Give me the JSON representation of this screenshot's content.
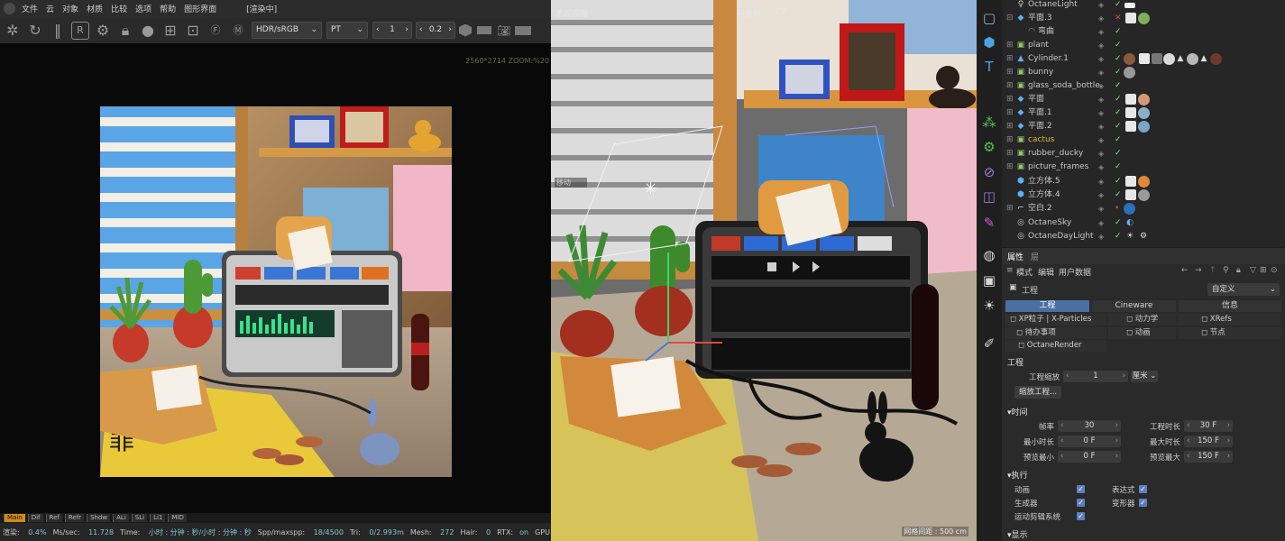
{
  "render_window": {
    "menu": [
      "文件",
      "云",
      "对象",
      "材质",
      "比较",
      "选项",
      "帮助",
      "图形界面",
      "[渲染中]"
    ],
    "color_space": "HDR/sRGB",
    "kernel": "PT",
    "spin1_value": "1",
    "spin2_value": "0.2",
    "zoom_info": "2560*2714 ZOOM:%20",
    "channels": [
      "Main",
      "Dif",
      "Ref",
      "Refr",
      "Shdw",
      "ALi",
      "SLi",
      "Li1",
      "MID"
    ],
    "status": {
      "render_label": "渲染:",
      "render_value": "0.4%",
      "ms_label": "Ms/sec:",
      "ms_value": "11.728",
      "time_label": "Time:",
      "time_value": "小时 : 分钟 : 秒/小时 : 分钟 : 秒",
      "spp_label": "Spp/maxspp:",
      "spp_value": "18/4500",
      "tri_label": "Tri:",
      "tri_value": "0/2.993m",
      "mesh_label": "Mesh:",
      "mesh_value": "272",
      "hair_label": "Hair:",
      "hair_value": "0",
      "rtx_label": "RTX:",
      "rtx_value": "on",
      "gpu_label": "GPU:",
      "gpu_value": "45"
    }
  },
  "viewport": {
    "title": "透视视图",
    "camera": "摄像机",
    "camera_icon": "▢⁴",
    "move_label": "移动",
    "grid_spacing": "网格间距 : 500 cm"
  },
  "palette": {
    "icons": [
      "cube-outline-icon",
      "cube-icon",
      "text-icon",
      "cloner-icon",
      "gear-generator-icon",
      "deformer-icon",
      "field-icon",
      "spline-pen-icon",
      "scene-globe-icon",
      "camera-icon",
      "light-icon",
      "sculpt-icon"
    ]
  },
  "object_manager": {
    "objects": [
      {
        "name": "OctaneLight",
        "color": "#d0d0d0"
      },
      {
        "name": "平面.3",
        "color": "#d0d0d0"
      },
      {
        "name": "弯曲",
        "color": "#d0d0d0"
      },
      {
        "name": "plant",
        "color": "#d0d0d0"
      },
      {
        "name": "Cylinder.1",
        "color": "#d0d0d0"
      },
      {
        "name": "bunny",
        "color": "#d0d0d0"
      },
      {
        "name": "glass_soda_bottle",
        "color": "#d0d0d0"
      },
      {
        "name": "平面",
        "color": "#d0d0d0"
      },
      {
        "name": "平面.1",
        "color": "#d0d0d0"
      },
      {
        "name": "平面.2",
        "color": "#d0d0d0"
      },
      {
        "name": "cactus",
        "color": "#e8b040"
      },
      {
        "name": "rubber_ducky",
        "color": "#d0d0d0"
      },
      {
        "name": "picture_frames",
        "color": "#d0d0d0"
      },
      {
        "name": "立方体.5",
        "color": "#d0d0d0"
      },
      {
        "name": "立方体.4",
        "color": "#d0d0d0"
      },
      {
        "name": "空白.2",
        "color": "#d0d0d0"
      },
      {
        "name": "OctaneSky",
        "color": "#d0d0d0"
      },
      {
        "name": "OctaneDayLight",
        "color": "#d0d0d0"
      }
    ]
  },
  "attributes": {
    "tabs_top": [
      "属性",
      "层"
    ],
    "menu": [
      "模式",
      "编辑",
      "用户数据"
    ],
    "object_name": "工程",
    "preset": "自定义",
    "main_tabs": [
      "工程",
      "Cineware",
      "信息"
    ],
    "sub_tabs": [
      "XP粒子 | X-Particles",
      "动力学",
      "XRefs",
      "待办事项",
      "动画",
      "节点",
      "OctaneRender"
    ],
    "section_project": "工程",
    "scale_label": "工程缩放",
    "scale_value": "1",
    "scale_unit": "厘米",
    "scale_button": "缩放工程...",
    "section_time": "时间",
    "fps_label": "帧率",
    "fps_value": "30",
    "duration_label": "工程时长",
    "duration_value": "30 F",
    "min_label": "最小时长",
    "min_value": "0 F",
    "max_label": "最大时长",
    "max_value": "150 F",
    "pmin_label": "预览最小",
    "pmin_value": "0 F",
    "pmax_label": "预览最大",
    "pmax_value": "150 F",
    "section_exec": "执行",
    "anim_label": "动画",
    "expr_label": "表达式",
    "gen_label": "生成器",
    "def_label": "变形器",
    "motion_label": "运动剪辑系统",
    "section_display": "显示"
  }
}
